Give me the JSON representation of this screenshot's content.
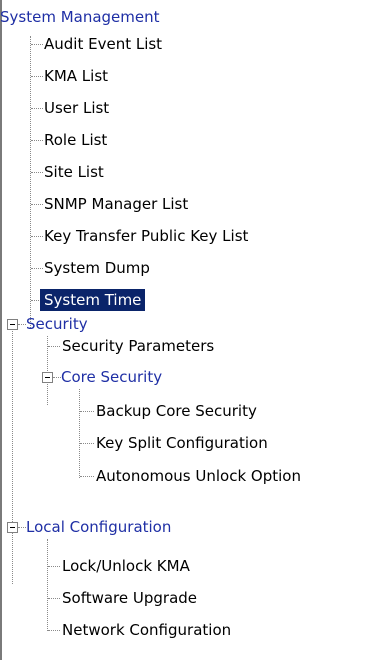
{
  "tree": {
    "root_label": "System Management",
    "items": [
      {
        "label": "Audit Event List"
      },
      {
        "label": "KMA List"
      },
      {
        "label": "User List"
      },
      {
        "label": "Role List"
      },
      {
        "label": "Site List"
      },
      {
        "label": "SNMP Manager List"
      },
      {
        "label": "Key Transfer Public Key List"
      },
      {
        "label": "System Dump"
      },
      {
        "label": "System Time",
        "selected": true
      }
    ],
    "security": {
      "label": "Security",
      "security_parameters": "Security Parameters",
      "core_security": {
        "label": "Core Security",
        "items": [
          {
            "label": "Backup Core Security"
          },
          {
            "label": "Key Split Configuration"
          },
          {
            "label": "Autonomous Unlock Option"
          }
        ]
      }
    },
    "local_configuration": {
      "label": "Local Configuration",
      "items": [
        {
          "label": "Lock/Unlock KMA"
        },
        {
          "label": "Software Upgrade"
        },
        {
          "label": "Network Configuration"
        }
      ]
    }
  }
}
